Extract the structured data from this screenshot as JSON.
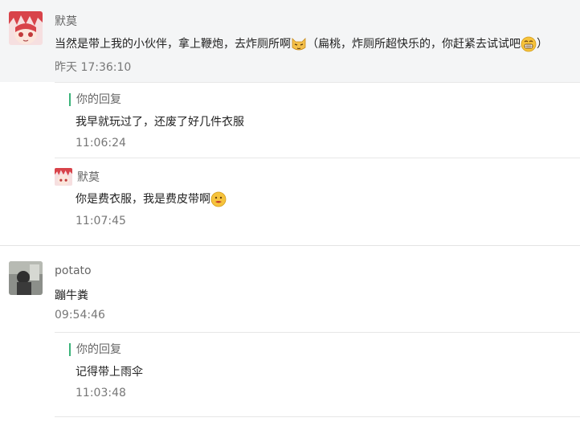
{
  "threads": [
    {
      "author": "默莫",
      "message_before": "当然是带上我的小伙伴，拿上鞭炮，去炸厕所啊",
      "message_middle": "（扁桃，炸厕所超快乐的，你赶紧去试试吧",
      "message_after": "）",
      "time": "昨天 17:36:10",
      "replies": [
        {
          "label": "你的回复",
          "message": "我早就玩过了，还废了好几件衣服",
          "time": "11:06:24"
        },
        {
          "author": "默莫",
          "message": "你是费衣服，我是费皮带啊",
          "time": "11:07:45"
        }
      ]
    },
    {
      "author": "potato",
      "message": "蹦牛粪",
      "time": "09:54:46",
      "replies": [
        {
          "label": "你的回复",
          "message": "记得带上雨伞",
          "time": "11:03:48"
        }
      ]
    }
  ]
}
